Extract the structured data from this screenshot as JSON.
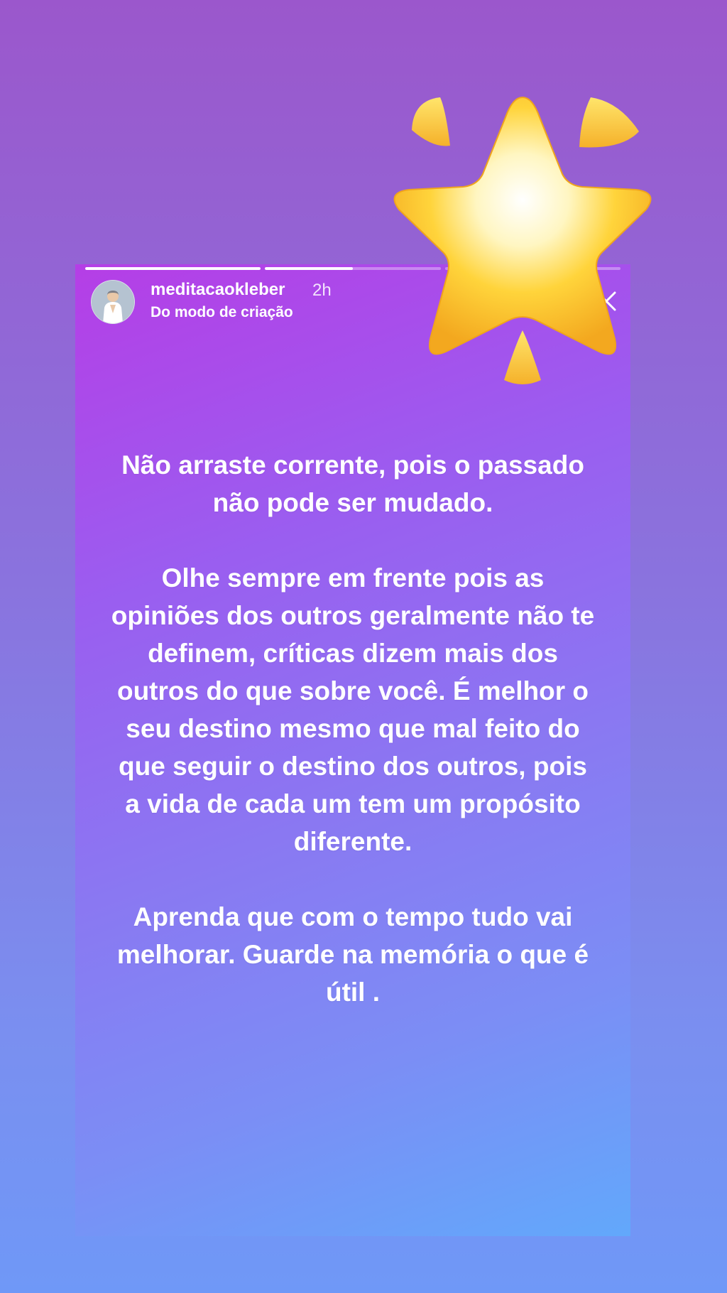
{
  "story": {
    "username": "meditacaokleber",
    "time": "2h",
    "subtitle": "Do modo de criação",
    "progress": [
      1.0,
      0.5,
      0.0
    ],
    "paragraphs": [
      "Não arraste corrente, pois o passado não pode ser mudado.",
      "Olhe sempre em frente pois as opiniões dos outros geralmente não te definem, críticas  dizem mais dos outros do que sobre você. É melhor o seu destino mesmo que mal feito do que seguir o destino dos outros, pois a vida de cada um tem um propósito diferente.",
      "Aprenda que com o tempo tudo vai melhorar. Guarde na memória o que é útil ."
    ]
  },
  "icons": {
    "close": "close-icon",
    "sticker": "glowing-star-icon",
    "avatar": "avatar"
  },
  "colors": {
    "bg_top": "#9b57cc",
    "bg_bottom": "#6f98f7",
    "card_top": "#b53ee6",
    "card_bottom": "#62a8fb",
    "text": "#ffffff",
    "star": "#ffd43b"
  }
}
